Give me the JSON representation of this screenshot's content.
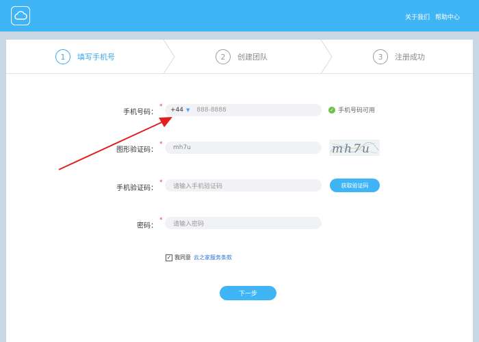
{
  "header": {
    "about_label": "关于我们",
    "help_label": "帮助中心"
  },
  "steps": [
    {
      "num": "1",
      "label": "填写手机号",
      "active": true
    },
    {
      "num": "2",
      "label": "创建团队",
      "active": false
    },
    {
      "num": "3",
      "label": "注册成功",
      "active": false
    }
  ],
  "form": {
    "phone_label": "手机号码：",
    "country_code": "+44",
    "phone_placeholder": "888-8888",
    "phone_status": "手机号码可用",
    "captcha_label": "图形验证码：",
    "captcha_value": "mh7u",
    "captcha_image_text": "mh7u",
    "sms_label": "手机验证码：",
    "sms_placeholder": "请输入手机验证码",
    "get_code_label": "获取验证码",
    "password_label": "密码：",
    "password_placeholder": "请输入密码",
    "required_mark": "*",
    "agree_text": "我同意",
    "terms_link": "云之家服务条款",
    "next_label": "下一步"
  },
  "colors": {
    "brand": "#3fb5f6",
    "active_step": "#3aa8ee",
    "required": "#e33333",
    "ok": "#6cc04a",
    "arrow": "#e02020"
  },
  "icons": [
    "cloud-icon",
    "chevron-down-icon",
    "check-circle-icon",
    "checkbox-icon"
  ]
}
